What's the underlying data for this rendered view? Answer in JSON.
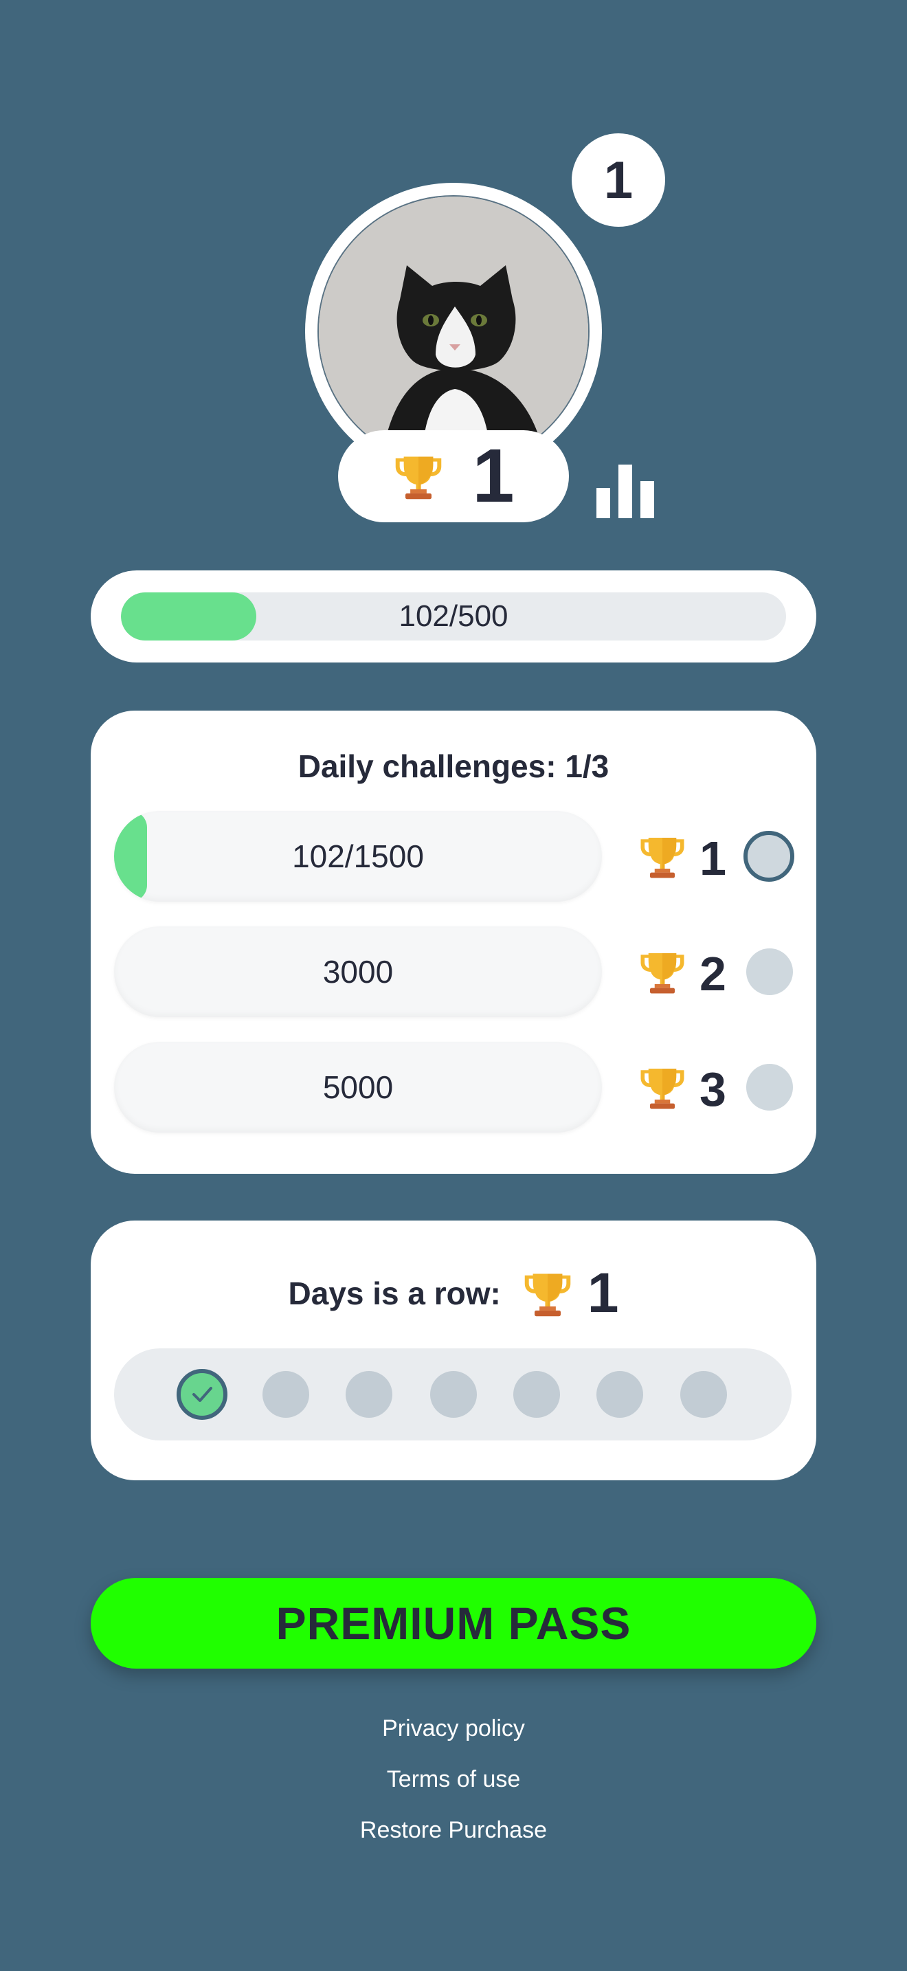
{
  "profile": {
    "level": "1",
    "trophies": "1",
    "avatar_alt": "cat"
  },
  "xp": {
    "text": "102/500",
    "progress": 0.204
  },
  "daily": {
    "title": "Daily challenges: 1/3",
    "challenges": [
      {
        "label": "102/1500",
        "progress": 0.068,
        "reward": "1",
        "active": true
      },
      {
        "label": "3000",
        "progress": 0,
        "reward": "2",
        "active": false
      },
      {
        "label": "5000",
        "progress": 0,
        "reward": "3",
        "active": false
      }
    ]
  },
  "streak": {
    "title": "Days is a row:",
    "count": "1",
    "days_completed": 1,
    "days_total": 7
  },
  "premium": {
    "label": "PREMIUM PASS"
  },
  "footer": {
    "privacy": "Privacy policy",
    "terms": "Terms of use",
    "restore": "Restore Purchase"
  },
  "colors": {
    "background": "#41667c",
    "progress": "#68e08d",
    "premium": "#20ff00",
    "trophy": "#f5b82e"
  },
  "icons": [
    "trophy-icon",
    "stats-icon",
    "checkmark-icon"
  ]
}
